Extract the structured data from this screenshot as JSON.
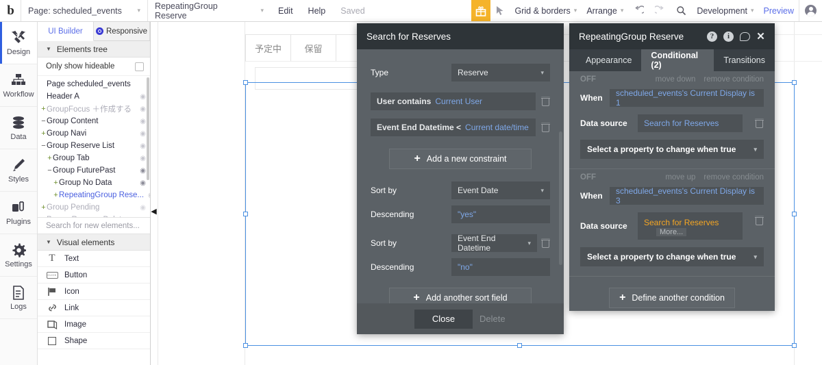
{
  "topbar": {
    "logo": "b",
    "page_selector": "Page: scheduled_events",
    "element_selector": "RepeatingGroup Reserve",
    "edit": "Edit",
    "help": "Help",
    "saved": "Saved",
    "gift_icon": "gift-icon",
    "cursor_icon": "cursor-icon",
    "grid_borders": "Grid & borders",
    "arrange": "Arrange",
    "undo_icon": "undo-icon",
    "redo_icon": "redo-icon",
    "search_icon": "search-icon",
    "version": "Development",
    "preview": "Preview",
    "avatar": "user-avatar"
  },
  "rail": [
    {
      "label": "Design",
      "icon": "design-icon",
      "active": true
    },
    {
      "label": "Workflow",
      "icon": "workflow-icon",
      "active": false
    },
    {
      "label": "Data",
      "icon": "data-icon",
      "active": false
    },
    {
      "label": "Styles",
      "icon": "styles-icon",
      "active": false
    },
    {
      "label": "Plugins",
      "icon": "plugins-icon",
      "active": false
    },
    {
      "label": "Settings",
      "icon": "settings-icon",
      "active": false
    },
    {
      "label": "Logs",
      "icon": "logs-icon",
      "active": false
    }
  ],
  "element_panel": {
    "tab_ui_builder": "UI Builder",
    "tab_responsive": "Responsive",
    "section_elements_tree": "Elements tree",
    "only_show_hideable": "Only show hideable",
    "search_placeholder": "Search for new elements...",
    "section_visual_elements": "Visual elements",
    "tree": [
      {
        "label": "Page scheduled_events",
        "indent": 0,
        "toggle": "",
        "state": "normal",
        "eye": "none"
      },
      {
        "label": "Header A",
        "indent": 0,
        "toggle": "",
        "state": "normal",
        "eye": "dim"
      },
      {
        "label": "GroupFocus ＋作成する",
        "indent": 0,
        "toggle": "+",
        "state": "dim",
        "eye": "dim"
      },
      {
        "label": "Group Content",
        "indent": 0,
        "toggle": "−",
        "state": "normal",
        "eye": "dim"
      },
      {
        "label": "Group Navi",
        "indent": 0,
        "toggle": "+",
        "state": "normal",
        "eye": "dim"
      },
      {
        "label": "Group Reserve List",
        "indent": 0,
        "toggle": "−",
        "state": "normal",
        "eye": "dim"
      },
      {
        "label": "Group Tab",
        "indent": 1,
        "toggle": "+",
        "state": "normal",
        "eye": "dim"
      },
      {
        "label": "Group FuturePast",
        "indent": 1,
        "toggle": "−",
        "state": "normal",
        "eye": "on"
      },
      {
        "label": "Group No Data",
        "indent": 2,
        "toggle": "+",
        "state": "normal",
        "eye": "on"
      },
      {
        "label": "RepeatingGroup Rese...",
        "indent": 2,
        "toggle": "+",
        "state": "selected",
        "eye": "dim"
      },
      {
        "label": "Group Pending",
        "indent": 0,
        "toggle": "+",
        "state": "dim",
        "eye": "off"
      },
      {
        "label": "Popup Reserve Delete",
        "indent": 0,
        "toggle": "+",
        "state": "dim",
        "eye": "off"
      }
    ],
    "visual_elements": [
      {
        "label": "Text",
        "icon": "text-icon"
      },
      {
        "label": "Button",
        "icon": "button-icon"
      },
      {
        "label": "Icon",
        "icon": "flag-icon"
      },
      {
        "label": "Link",
        "icon": "link-icon"
      },
      {
        "label": "Image",
        "icon": "image-icon"
      },
      {
        "label": "Shape",
        "icon": "shape-icon"
      }
    ]
  },
  "canvas": {
    "tabs": [
      "予定中",
      "保留"
    ],
    "selection": {
      "element": "RepeatingGroup Reserve"
    }
  },
  "search_dialog": {
    "title": "Search for Reserves",
    "type_label": "Type",
    "type_value": "Reserve",
    "constraints": [
      {
        "field": "User contains",
        "value": "Current User"
      },
      {
        "field": "Event End Datetime <",
        "value": "Current date/time"
      }
    ],
    "add_constraint": "Add a new constraint",
    "sorts": [
      {
        "sort_label": "Sort by",
        "sort_value": "Event Date",
        "desc_label": "Descending",
        "desc_value": "\"yes\"",
        "deletable": false
      },
      {
        "sort_label": "Sort by",
        "sort_value": "Event End Datetime",
        "desc_label": "Descending",
        "desc_value": "\"no\"",
        "deletable": true
      }
    ],
    "add_sort": "Add another sort field",
    "close": "Close",
    "delete": "Delete"
  },
  "rg_dialog": {
    "title": "RepeatingGroup Reserve",
    "header_icons": [
      "help-icon",
      "info-icon",
      "comment-icon",
      "close-icon"
    ],
    "tabs": [
      {
        "label": "Appearance",
        "active": false
      },
      {
        "label": "Conditional (2)",
        "active": true
      },
      {
        "label": "Transitions",
        "active": false
      }
    ],
    "conditions": [
      {
        "state": "OFF",
        "move": "move down",
        "remove": "remove condition",
        "when_label": "When",
        "when_value": "scheduled_events's Current Display is 1",
        "ds_label": "Data source",
        "ds_value": "Search for Reserves",
        "ds_more": "",
        "ds_color": "blue",
        "property_placeholder": "Select a property to change when true"
      },
      {
        "state": "OFF",
        "move": "move up",
        "remove": "remove condition",
        "when_label": "When",
        "when_value": "scheduled_events's Current Display is 3",
        "ds_label": "Data source",
        "ds_value": "Search for Reserves",
        "ds_more": "More...",
        "ds_color": "orange",
        "property_placeholder": "Select a property to change when true"
      }
    ],
    "define_another": "Define another condition"
  },
  "colors": {
    "dialog_header": "#2e3438",
    "dialog_body": "#5b6166",
    "field": "#4d5256",
    "accent_blue": "#7fa8e8",
    "accent_orange": "#f5a623",
    "selection_blue": "#4a90e2",
    "gift_yellow": "#f5b32a",
    "rail_active": "#2f5fe0"
  }
}
